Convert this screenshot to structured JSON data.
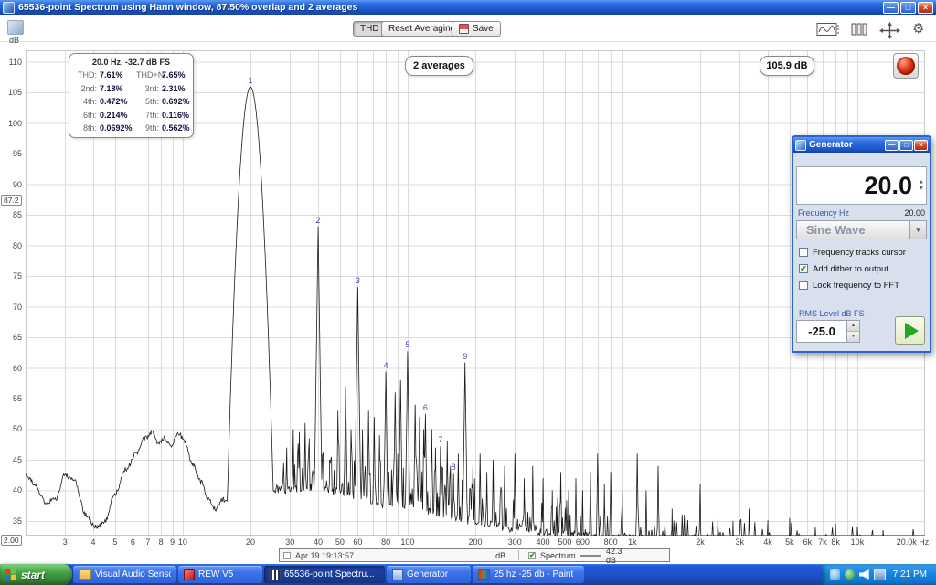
{
  "window": {
    "title": "65536-point Spectrum using Hann window, 87.50% overlap and 2 averages"
  },
  "toolbar": {
    "thd_label": "THD",
    "reset_label": "Reset Averaging",
    "save_label": "Save",
    "right_icons": [
      "signal-display-icon",
      "columns-icon",
      "pan-crosshair-icon",
      "settings-gear-icon"
    ]
  },
  "axes": {
    "y_title": "dB",
    "y_cursor": "87.2",
    "x_cursor": "2.00"
  },
  "overlays": {
    "averages": "2 averages",
    "peak": "105.9 dB",
    "info": {
      "header": "20.0 Hz, -32.7 dB FS",
      "rows": [
        {
          "l1": "THD:",
          "v1": "7.61%",
          "l2": "THD+N:",
          "v2": "7.65%"
        },
        {
          "l1": "2nd:",
          "v1": "7.18%",
          "l2": "3rd:",
          "v2": "2.31%"
        },
        {
          "l1": "4th:",
          "v1": "0.472%",
          "l2": "5th:",
          "v2": "0.692%"
        },
        {
          "l1": "6th:",
          "v1": "0.214%",
          "l2": "7th:",
          "v2": "0.116%"
        },
        {
          "l1": "8th:",
          "v1": "0.0692%",
          "l2": "9th:",
          "v2": "0.562%"
        }
      ]
    }
  },
  "generator": {
    "title": "Generator",
    "frequency_display": "20.0",
    "frequency_label": "Frequency Hz",
    "frequency_value": "20.00",
    "waveform": "Sine Wave",
    "checkboxes": [
      {
        "label": "Frequency tracks cursor",
        "checked": false
      },
      {
        "label": "Add dither to output",
        "checked": true
      },
      {
        "label": "Lock frequency to FFT",
        "checked": false
      }
    ],
    "rms_label": "RMS Level dB FS",
    "rms_value": "-25.0"
  },
  "legend": {
    "timestamp": "Apr 19 19:13:57",
    "unit": "dB",
    "trace_label": "Spectrum",
    "trace_value": "42.3 dB"
  },
  "taskbar": {
    "start_label": "start",
    "items": [
      {
        "label": "Visual Audio Sensory ...",
        "icon": "folder",
        "active": false
      },
      {
        "label": "REW V5",
        "icon": "rew",
        "active": false
      },
      {
        "label": "65536-point Spectru...",
        "icon": "spectrum",
        "active": true
      },
      {
        "label": "Generator",
        "icon": "generator",
        "active": false
      },
      {
        "label": "25 hz -25 db - Paint",
        "icon": "paint",
        "active": false
      }
    ],
    "tray_icons": [
      "display-tray-icon",
      "status-tray-icon",
      "volume-tray-icon",
      "network-tray-icon"
    ],
    "clock": "7:21 PM"
  },
  "chart_data": {
    "type": "line",
    "title": "Spectrum",
    "xlabel": "Hz",
    "ylabel": "dB",
    "x_scale": "log",
    "grid": true,
    "line_color": "#1a1a1a",
    "xlim": [
      2,
      20000
    ],
    "ylim": [
      32.6,
      111.9
    ],
    "y_gridlines": [
      35,
      40,
      45,
      50,
      55,
      60,
      65,
      70,
      75,
      80,
      85,
      90,
      95,
      100,
      105,
      110
    ],
    "x_gridlines": [
      2,
      3,
      4,
      5,
      6,
      7,
      8,
      9,
      10,
      20,
      30,
      40,
      50,
      60,
      70,
      80,
      90,
      100,
      200,
      300,
      400,
      500,
      600,
      700,
      800,
      900,
      1000,
      2000,
      3000,
      4000,
      5000,
      6000,
      7000,
      8000,
      9000,
      10000,
      20000
    ],
    "x_ticks": [
      [
        3,
        "3"
      ],
      [
        4,
        "4"
      ],
      [
        5,
        "5"
      ],
      [
        6,
        "6"
      ],
      [
        7,
        "7"
      ],
      [
        8,
        "8"
      ],
      [
        9,
        "9"
      ],
      [
        10,
        "10"
      ],
      [
        20,
        "20"
      ],
      [
        30,
        "30"
      ],
      [
        40,
        "40"
      ],
      [
        50,
        "50"
      ],
      [
        60,
        "60"
      ],
      [
        80,
        "80"
      ],
      [
        100,
        "100"
      ],
      [
        200,
        "200"
      ],
      [
        300,
        "300"
      ],
      [
        400,
        "400"
      ],
      [
        500,
        "500"
      ],
      [
        600,
        "600"
      ],
      [
        800,
        "800"
      ],
      [
        1000,
        "1k"
      ],
      [
        2000,
        "2k"
      ],
      [
        3000,
        "3k"
      ],
      [
        4000,
        "4k"
      ],
      [
        5000,
        "5k"
      ],
      [
        6000,
        "6k"
      ],
      [
        7000,
        "7k"
      ],
      [
        8000,
        "8k"
      ],
      [
        10000,
        "10k"
      ],
      [
        20000,
        "20.0k Hz"
      ]
    ],
    "harmonics": [
      {
        "n": "1",
        "freq": 20,
        "db": 105.9
      },
      {
        "n": "2",
        "freq": 40,
        "db": 83.1
      },
      {
        "n": "3",
        "freq": 60,
        "db": 73.2
      },
      {
        "n": "4",
        "freq": 80,
        "db": 59.4
      },
      {
        "n": "5",
        "freq": 100,
        "db": 62.7
      },
      {
        "n": "6",
        "freq": 120,
        "db": 52.5
      },
      {
        "n": "7",
        "freq": 140,
        "db": 47.2
      },
      {
        "n": "8",
        "freq": 160,
        "db": 42.7
      },
      {
        "n": "9",
        "freq": 180,
        "db": 60.9
      }
    ],
    "low_freq_curve": [
      [
        2,
        42.5
      ],
      [
        2.2,
        41
      ],
      [
        2.45,
        38
      ],
      [
        2.7,
        38.5
      ],
      [
        3.0,
        42.5
      ],
      [
        3.3,
        41.5
      ],
      [
        3.7,
        36
      ],
      [
        4.1,
        34
      ],
      [
        4.5,
        35
      ],
      [
        5.0,
        39.5
      ],
      [
        5.6,
        43.5
      ],
      [
        6.2,
        46
      ],
      [
        6.8,
        48.5
      ],
      [
        7.3,
        49.5
      ],
      [
        7.8,
        47.5
      ],
      [
        8.3,
        48.5
      ],
      [
        8.9,
        47
      ],
      [
        9.5,
        49.5
      ],
      [
        10.2,
        48
      ],
      [
        11,
        44.5
      ],
      [
        12,
        41.5
      ],
      [
        13,
        38.5
      ],
      [
        14,
        37
      ],
      [
        15,
        38.5
      ],
      [
        15.3,
        39.5
      ]
    ],
    "noise_floor": [
      [
        15,
        39.5
      ],
      [
        18,
        40.5
      ],
      [
        25,
        41
      ],
      [
        30,
        41
      ],
      [
        40,
        41.5
      ],
      [
        50,
        40.5
      ],
      [
        60,
        40
      ],
      [
        80,
        38.5
      ],
      [
        100,
        38.5
      ],
      [
        140,
        37
      ],
      [
        200,
        35.8
      ],
      [
        300,
        34.6
      ],
      [
        500,
        33.8
      ],
      [
        800,
        33.2
      ],
      [
        1500,
        32.9
      ],
      [
        20000,
        32.7
      ]
    ],
    "noise_amp": [
      [
        15,
        1
      ],
      [
        26,
        2
      ],
      [
        28,
        8
      ],
      [
        40,
        9
      ],
      [
        100,
        9
      ],
      [
        200,
        8
      ],
      [
        400,
        7
      ],
      [
        700,
        6
      ],
      [
        1200,
        5
      ],
      [
        3000,
        4
      ],
      [
        20000,
        2.5
      ]
    ],
    "noise_prob": [
      [
        15,
        0.3
      ],
      [
        27,
        0.5
      ],
      [
        150,
        0.5
      ],
      [
        300,
        0.42
      ],
      [
        700,
        0.3
      ],
      [
        1500,
        0.22
      ],
      [
        4000,
        0.15
      ],
      [
        20000,
        0.12
      ]
    ],
    "spikes": [
      [
        29,
        47
      ],
      [
        31,
        50
      ],
      [
        33,
        49.5
      ],
      [
        35,
        51
      ],
      [
        36.5,
        48
      ],
      [
        45,
        45
      ],
      [
        49,
        53
      ],
      [
        53,
        57
      ],
      [
        56,
        50
      ],
      [
        63,
        50
      ],
      [
        67,
        53
      ],
      [
        71,
        52
      ],
      [
        75,
        49
      ],
      [
        88,
        56
      ],
      [
        93,
        58
      ],
      [
        108,
        54
      ],
      [
        113,
        52
      ],
      [
        118,
        50
      ],
      [
        128,
        50
      ],
      [
        133,
        47
      ],
      [
        150,
        48
      ],
      [
        155,
        44
      ],
      [
        168,
        46
      ],
      [
        195,
        44
      ],
      [
        210,
        46
      ],
      [
        225,
        43
      ],
      [
        240,
        45
      ],
      [
        270,
        44
      ],
      [
        300,
        46
      ],
      [
        330,
        42
      ],
      [
        360,
        44
      ],
      [
        400,
        42
      ],
      [
        440,
        40
      ],
      [
        480,
        43
      ],
      [
        520,
        40
      ],
      [
        560,
        42
      ],
      [
        600,
        40
      ],
      [
        650,
        43
      ],
      [
        700,
        46
      ],
      [
        750,
        41
      ],
      [
        800,
        43
      ],
      [
        900,
        40
      ],
      [
        1050,
        46
      ],
      [
        1150,
        40
      ],
      [
        1300,
        44
      ],
      [
        1500,
        37
      ],
      [
        1700,
        36
      ],
      [
        2000,
        41
      ],
      [
        2400,
        36
      ],
      [
        2800,
        35
      ],
      [
        3300,
        37
      ],
      [
        4000,
        34.5
      ],
      [
        5000,
        35.5
      ],
      [
        6500,
        34
      ],
      [
        8000,
        34.5
      ],
      [
        10000,
        34
      ],
      [
        13000,
        33.5
      ]
    ]
  }
}
